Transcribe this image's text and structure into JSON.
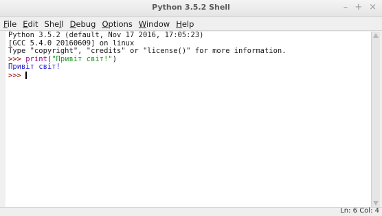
{
  "window": {
    "title": "Python 3.5.2 Shell",
    "controls": {
      "minimize": "–",
      "maximize": "+",
      "close": "×"
    }
  },
  "menubar": {
    "items": [
      {
        "label": "File",
        "underline_index": 0
      },
      {
        "label": "Edit",
        "underline_index": 0
      },
      {
        "label": "Shell",
        "underline_index": 3
      },
      {
        "label": "Debug",
        "underline_index": 0
      },
      {
        "label": "Options",
        "underline_index": 0
      },
      {
        "label": "Window",
        "underline_index": 0
      },
      {
        "label": "Help",
        "underline_index": 0
      }
    ]
  },
  "shell": {
    "banner": [
      "Python 3.5.2 (default, Nov 17 2016, 17:05:23)",
      "[GCC 5.4.0 20160609] on linux",
      "Type \"copyright\", \"credits\" or \"license()\" for more information."
    ],
    "prompt": ">>> ",
    "command_keyword": "print",
    "command_open": "(",
    "command_string": "\"Привіт світ!\"",
    "command_close": ")",
    "output": "Привіт світ!",
    "current_prompt": ">>> "
  },
  "statusbar": {
    "text": "Ln: 6  Col: 4"
  },
  "colors": {
    "prompt": "#8b0000",
    "keyword": "#8b008b",
    "string": "#1a9a1a",
    "stdout": "#1a1ad0"
  }
}
